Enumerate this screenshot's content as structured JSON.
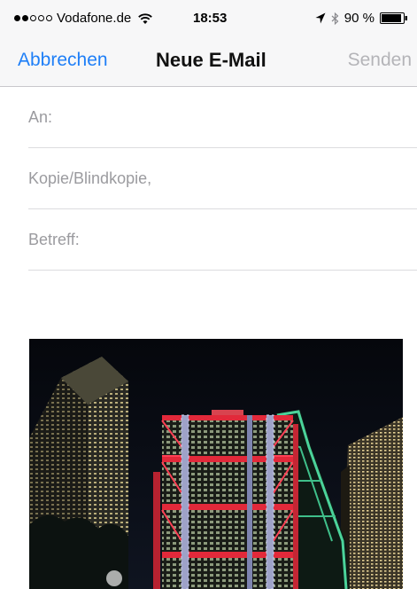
{
  "status_bar": {
    "signal_dots_filled": 2,
    "signal_dots_total": 5,
    "carrier": "Vodafone.de",
    "time": "18:53",
    "battery": "90 %",
    "icons": [
      "wifi-icon",
      "location-arrow-icon",
      "bluetooth-icon",
      "battery-icon"
    ]
  },
  "nav": {
    "cancel_label": "Abbrechen",
    "title": "Neue E-Mail",
    "send_label": "Senden"
  },
  "fields": {
    "to_label": "An:",
    "cc_label": "Kopie/Blindkopie,",
    "subject_label": "Betreff:"
  },
  "attachment": {
    "type": "photo"
  },
  "colors": {
    "accent": "#1f7ff7",
    "disabled": "#b4b4b8",
    "placeholder": "#9b9b9f",
    "bar_background": "#f7f7f8"
  }
}
